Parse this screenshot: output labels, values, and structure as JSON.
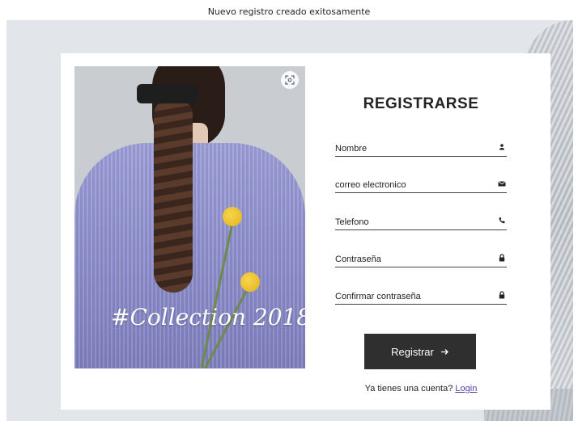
{
  "toast": {
    "message": "Nuevo registro creado exitosamente"
  },
  "hero": {
    "caption": "#Collection 2018",
    "scan_icon": "scan-icon"
  },
  "form": {
    "title": "REGISTRARSE",
    "fields": {
      "nombre": {
        "placeholder": "Nombre",
        "icon": "user-icon"
      },
      "correo": {
        "placeholder": "correo electronico",
        "icon": "envelope-icon"
      },
      "telefono": {
        "placeholder": "Telefono",
        "icon": "phone-icon"
      },
      "contrasena": {
        "placeholder": "Contraseña",
        "icon": "lock-icon"
      },
      "confirmar": {
        "placeholder": "Confirmar contraseña",
        "icon": "lock-icon"
      }
    },
    "submit": {
      "label": "Registrar",
      "icon": "arrow-right-icon"
    },
    "login_prompt": "Ya tienes una cuenta?",
    "login_link": "Login"
  },
  "colors": {
    "button_bg": "#2f2f2f",
    "link": "#5a3ea8",
    "backdrop": "#e2e6ea"
  }
}
